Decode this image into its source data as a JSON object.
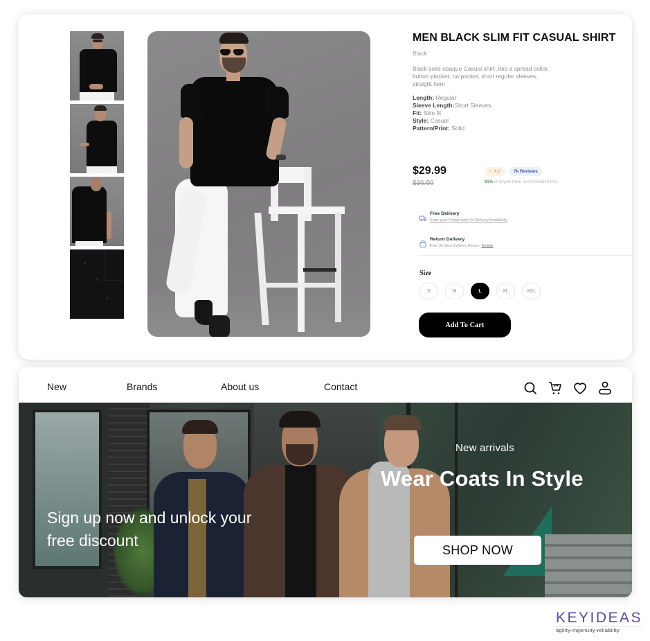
{
  "product": {
    "title": "MEN BLACK SLIM FIT CASUAL SHIRT",
    "color": "Black",
    "description": "Black solid opaque Casual shirt ,has a spread collar, button placket, na pocket, short regular sleeves, straight hem",
    "specs": [
      {
        "label": "Length",
        "sep": ": ",
        "value": "Regular"
      },
      {
        "label": "Sleeve Length",
        "sep": ":",
        "value": "Short Sleeves"
      },
      {
        "label": "Fit",
        "sep": ": ",
        "value": "Slim fit"
      },
      {
        "label": "Style",
        "sep": ": ",
        "value": "Casual"
      },
      {
        "label": "Pattern/Print",
        "sep": ": ",
        "value": "Solid"
      }
    ],
    "price": "$29.99",
    "old_price": "$36.99",
    "rating": "4.2",
    "reviews": "7k Reviews",
    "recommend_pct": "91%",
    "recommend_text": " of buyers have recommended this.",
    "delivery": {
      "free_title": "Free Delivery",
      "free_sub": "Enter your Postal code for Delivery Availability",
      "return_title": "Return Delivery",
      "return_sub": "Free 30 days Delivery Return. ",
      "return_link": "Details"
    },
    "size_label": "Size",
    "sizes": [
      "S",
      "M",
      "L",
      "XL",
      "XXL"
    ],
    "selected_size": "L",
    "add_to_cart": "Add To Cart",
    "thumbnails": [
      "front-seated",
      "side-pose",
      "back-view",
      "fabric-closeup"
    ]
  },
  "store": {
    "nav": [
      "New",
      "Brands",
      "About us",
      "Contact"
    ],
    "icons": [
      "search-icon",
      "cart-icon",
      "heart-icon",
      "user-icon"
    ],
    "hero": {
      "subtitle": "New arrivals",
      "title": "Wear Coats In Style",
      "signup": "Sign up now and unlock your free discount",
      "cta": "SHOP NOW"
    }
  },
  "brand": {
    "name": "KEYIDEAS",
    "tagline": "agility-ingenuity-reliability",
    "color": "#5d4a9c"
  }
}
